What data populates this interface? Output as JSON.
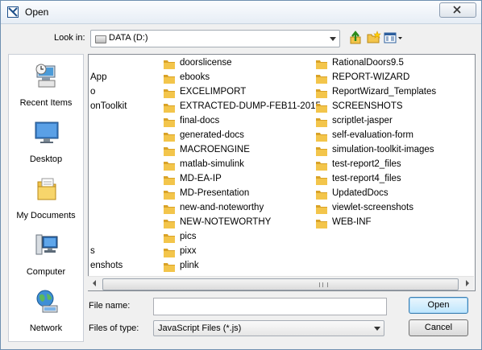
{
  "window": {
    "title": "Open",
    "close_label": "close"
  },
  "lookin": {
    "label": "Look in:",
    "value": "DATA (D:)"
  },
  "toolbar": {
    "up_icon": "up-folder-icon",
    "new_folder_icon": "new-folder-icon",
    "view_menu_icon": "view-menu-icon"
  },
  "places": [
    {
      "label": "Recent Items",
      "icon": "recent-items-icon"
    },
    {
      "label": "Desktop",
      "icon": "desktop-icon"
    },
    {
      "label": "My Documents",
      "icon": "my-documents-icon"
    },
    {
      "label": "Computer",
      "icon": "computer-icon"
    },
    {
      "label": "Network",
      "icon": "network-icon"
    }
  ],
  "files": {
    "col0": [
      "",
      "App",
      "o",
      "onToolkit",
      "",
      "",
      "",
      "",
      "",
      "",
      "",
      "",
      "",
      "s",
      "enshots"
    ],
    "col1": [
      "doorslicense",
      "ebooks",
      "EXCELIMPORT",
      "EXTRACTED-DUMP-FEB11-2015",
      "final-docs",
      "generated-docs",
      "MACROENGINE",
      "matlab-simulink",
      "MD-EA-IP",
      "MD-Presentation",
      "new-and-noteworthy",
      "NEW-NOTEWORTHY",
      "pics",
      "pixx",
      "plink"
    ],
    "col2": [
      "RationalDoors9.5",
      "REPORT-WIZARD",
      "ReportWizard_Templates",
      "SCREENSHOTS",
      "scriptlet-jasper",
      "self-evaluation-form",
      "simulation-toolkit-images",
      "test-report2_files",
      "test-report4_files",
      "UpdatedDocs",
      "viewlet-screenshots",
      "WEB-INF"
    ]
  },
  "filename": {
    "label": "File name:",
    "value": "",
    "placeholder": ""
  },
  "filetype": {
    "label": "Files of type:",
    "value": "JavaScript Files (*.js)"
  },
  "buttons": {
    "open": "Open",
    "cancel": "Cancel"
  },
  "colors": {
    "folder": "#f3c54b",
    "folder_dark": "#d9a227",
    "accent": "#3c7fb1"
  }
}
